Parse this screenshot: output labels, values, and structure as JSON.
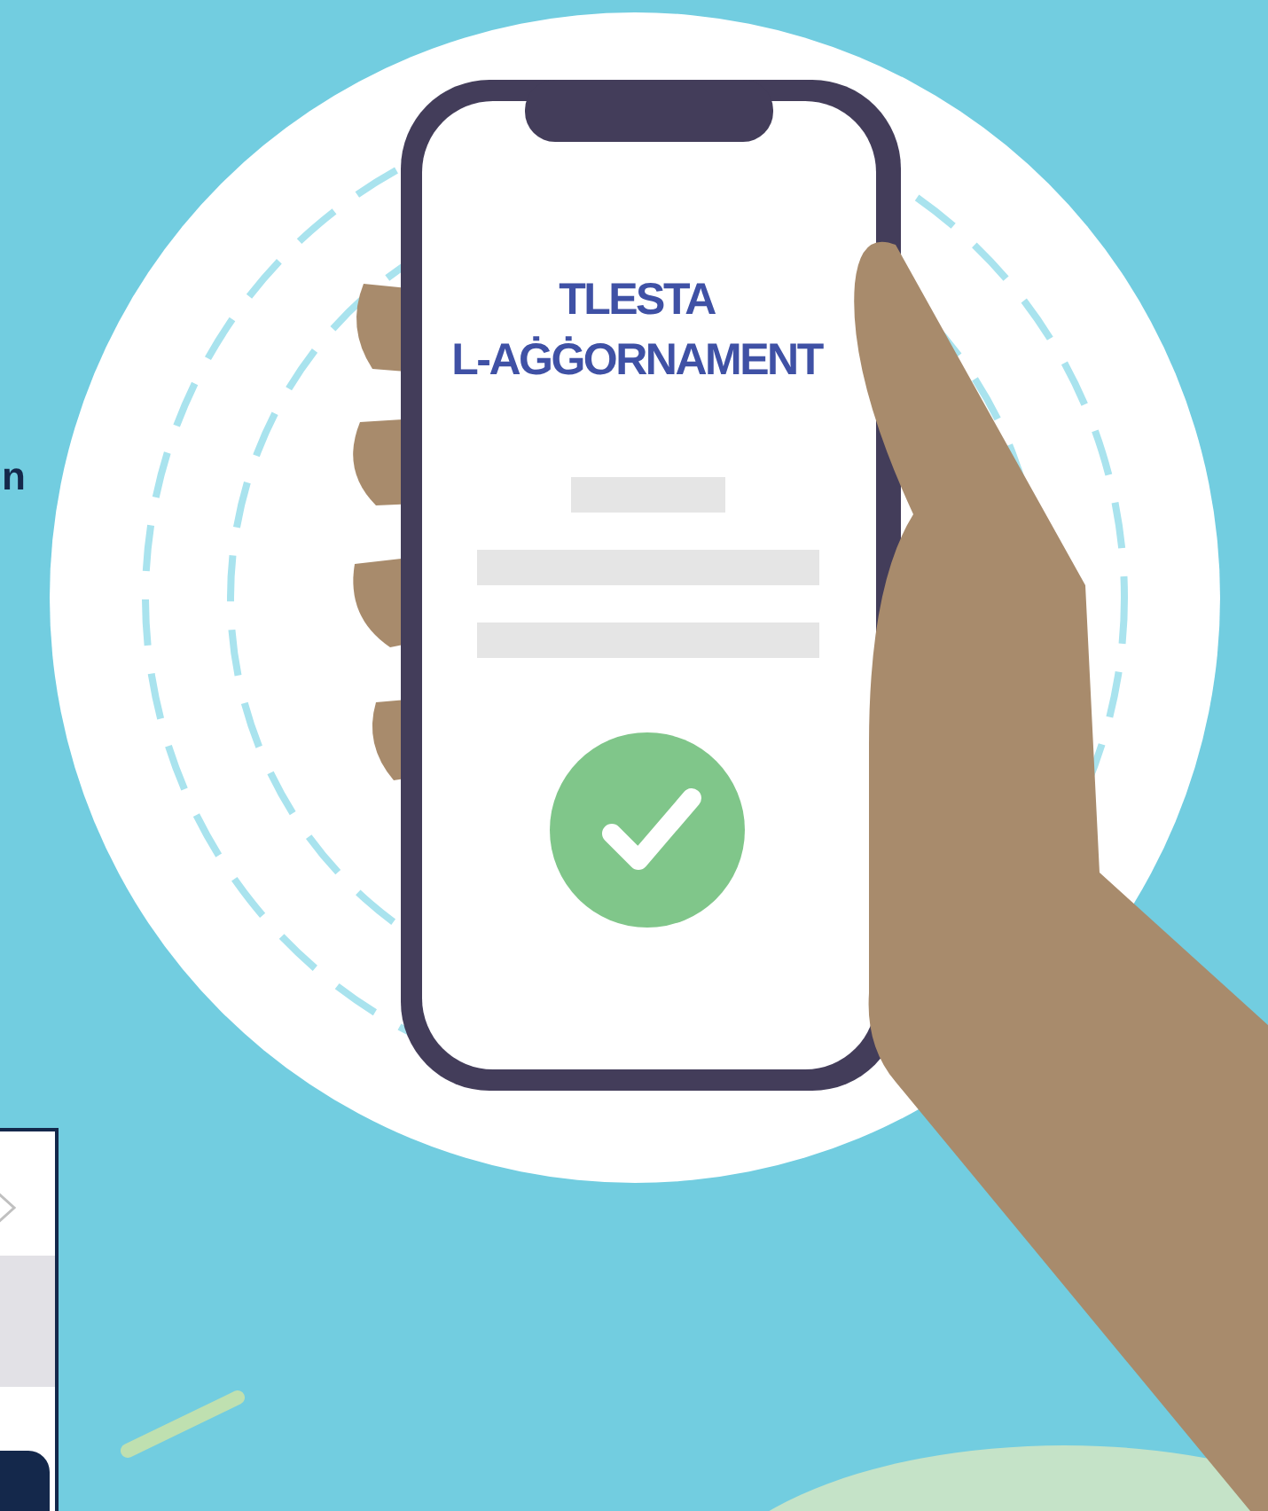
{
  "side_text": "n",
  "phone": {
    "title_lines": [
      "TLESTA",
      "L-AĠĠORNAMENT"
    ],
    "verified": true
  }
}
